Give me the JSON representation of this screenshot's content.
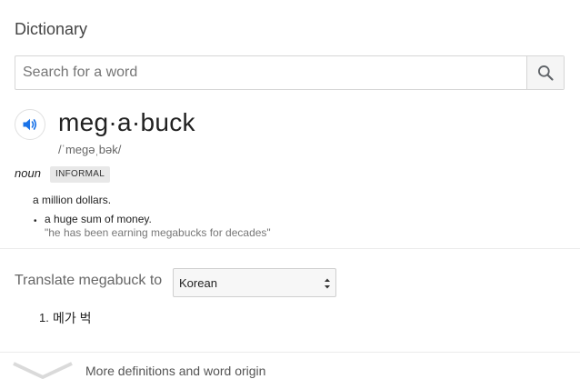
{
  "card": {
    "title": "Dictionary"
  },
  "search": {
    "placeholder": "Search for a word",
    "value": "",
    "button_icon": "search-icon"
  },
  "entry": {
    "speaker_icon": "speaker-icon",
    "headword": "meg·a·buck",
    "pronunciation": "/ˈmeɡəˌbək/",
    "part_of_speech": "noun",
    "register_badge": "INFORMAL",
    "definitions": [
      {
        "text": "a million dollars."
      },
      {
        "bullet": "•",
        "text": "a huge sum of money.",
        "example": "\"he has been earning megabucks for decades\""
      }
    ]
  },
  "translate": {
    "label": "Translate megabuck to",
    "selected_language": "Korean",
    "results": [
      {
        "number": "1.",
        "text": "메가 벅"
      }
    ]
  },
  "footer": {
    "expand_icon": "chevron-down-icon",
    "more_label": "More definitions and word origin"
  },
  "colors": {
    "accent": "#1a73e8",
    "muted_text": "#666666",
    "divider": "#ebebeb"
  }
}
